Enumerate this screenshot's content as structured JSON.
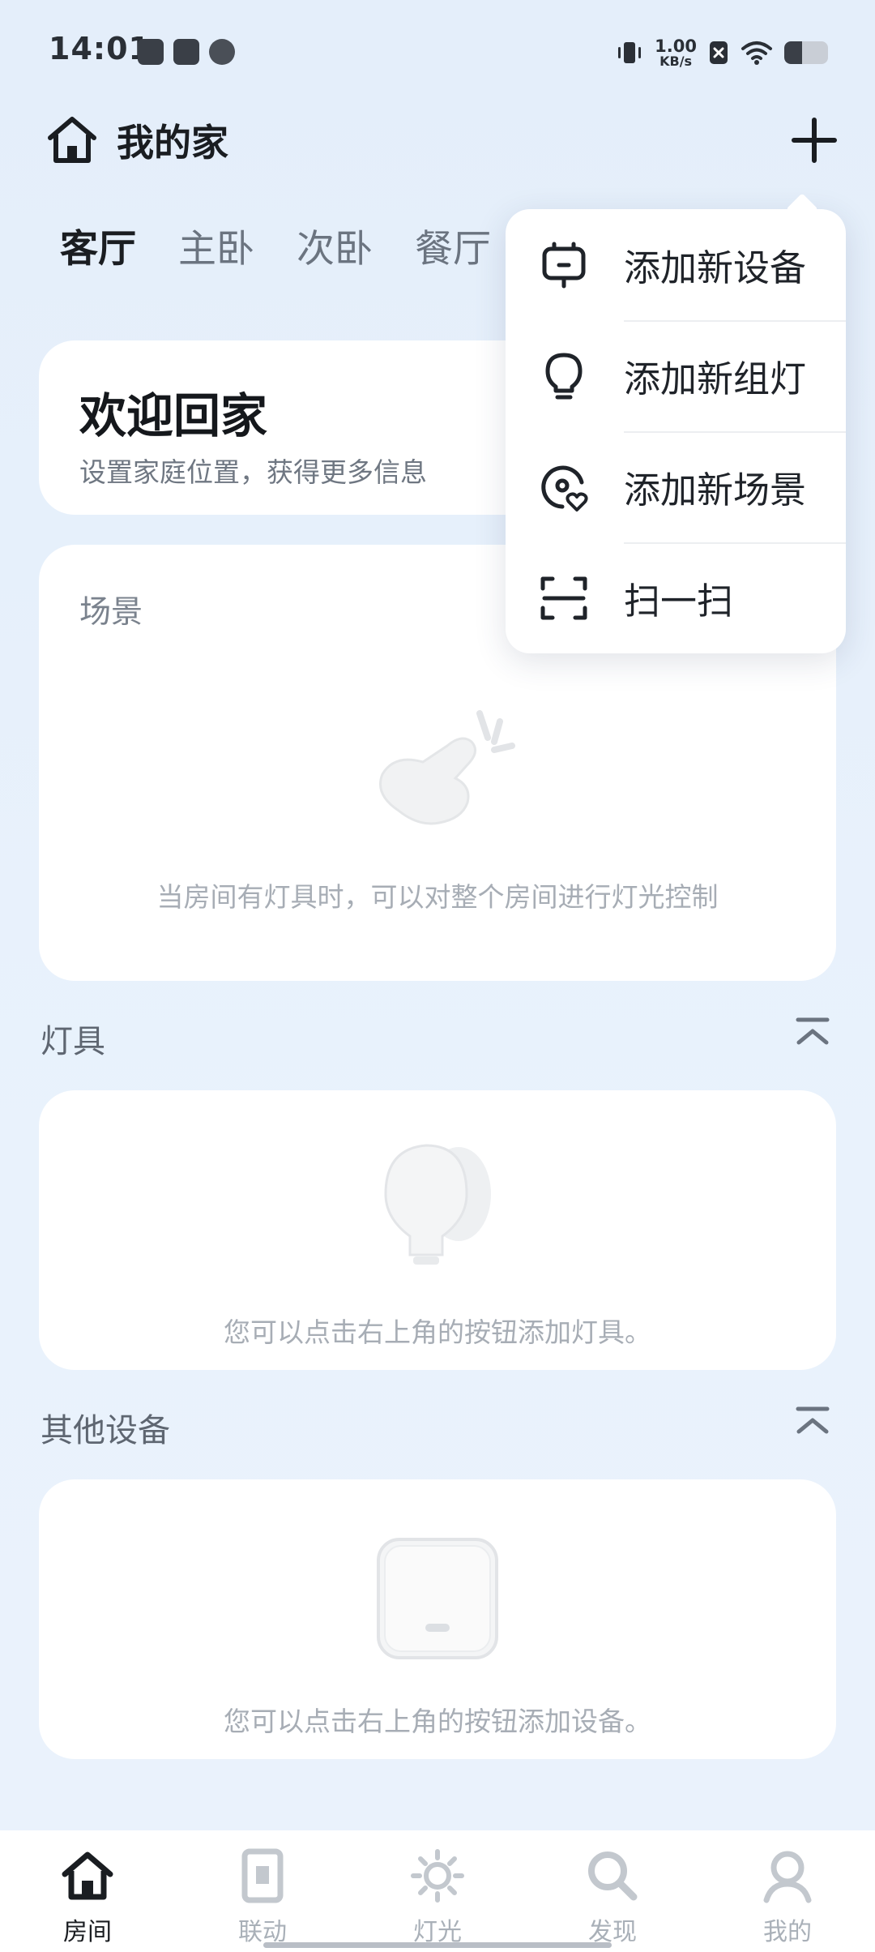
{
  "status_bar": {
    "time": "14:01",
    "net_speed_value": "1.00",
    "net_speed_unit": "KB/s",
    "battery_level": 0.4,
    "icons": [
      "app-notification-icon",
      "mail-icon",
      "cat-app-icon",
      "vibrate-icon",
      "sim-disabled-icon",
      "wifi-icon",
      "battery-icon"
    ]
  },
  "header": {
    "home_name": "我的家",
    "home_icon": "house-icon",
    "add_icon": "plus-icon"
  },
  "tabs": [
    {
      "label": "客厅",
      "active": true
    },
    {
      "label": "主卧",
      "active": false
    },
    {
      "label": "次卧",
      "active": false
    },
    {
      "label": "餐厅",
      "active": false
    }
  ],
  "welcome": {
    "title": "欢迎回家",
    "subtitle": "设置家庭位置，获得更多信息"
  },
  "scene": {
    "label": "场景",
    "empty_text": "当房间有灯具时，可以对整个房间进行灯光控制",
    "illustration": "tap-hand-icon"
  },
  "lamps": {
    "title": "灯具",
    "empty_text": "您可以点击右上角的按钮添加灯具。",
    "illustration": "lightbulb-icon"
  },
  "other_devices": {
    "title": "其他设备",
    "empty_text": "您可以点击右上角的按钮添加设备。",
    "illustration": "switch-panel-icon"
  },
  "menu": {
    "items": [
      {
        "label": "添加新设备",
        "icon": "device-icon"
      },
      {
        "label": "添加新组灯",
        "icon": "bulb-outline-icon"
      },
      {
        "label": "添加新场景",
        "icon": "scene-heart-icon"
      },
      {
        "label": "扫一扫",
        "icon": "scan-icon"
      }
    ]
  },
  "bottom_nav": {
    "items": [
      {
        "label": "房间",
        "icon": "house-filled-icon",
        "active": true
      },
      {
        "label": "联动",
        "icon": "switch-icon",
        "active": false
      },
      {
        "label": "灯光",
        "icon": "sun-icon",
        "active": false
      },
      {
        "label": "发现",
        "icon": "search-icon",
        "active": false
      },
      {
        "label": "我的",
        "icon": "person-icon",
        "active": false
      }
    ]
  },
  "colors": {
    "background": "#e6f0fb",
    "card": "#ffffff",
    "text_primary": "#1a1d21",
    "text_muted": "#a7adb5"
  }
}
